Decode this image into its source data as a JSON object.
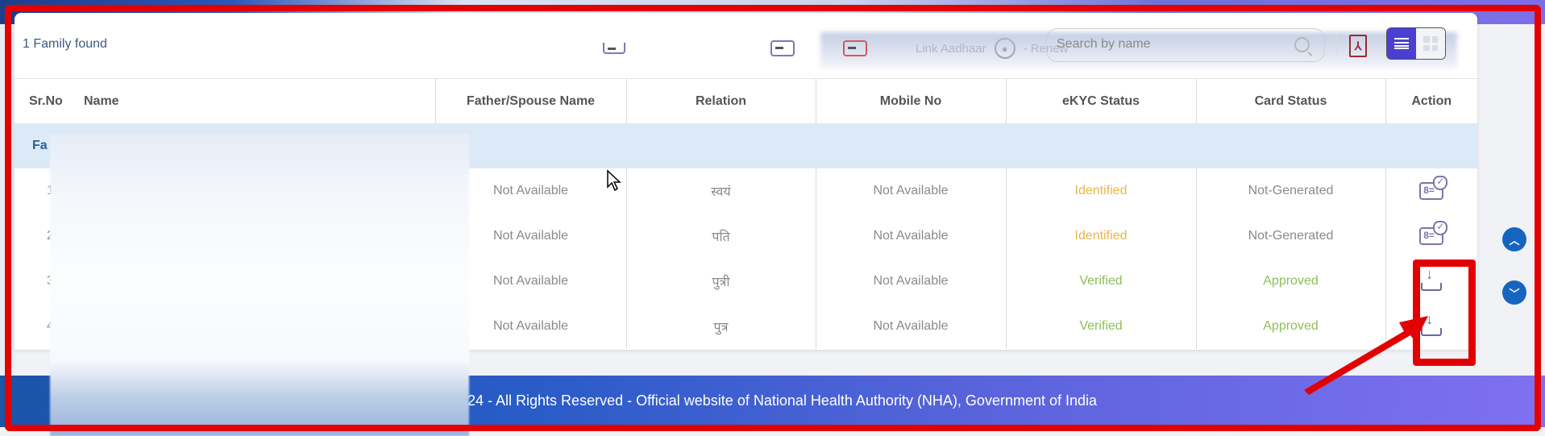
{
  "toolbar": {
    "family_count": "1 Family found",
    "legend": {
      "link_aadhaar_label": "Link Aadhaar",
      "renew_label": "- Renew"
    },
    "search": {
      "placeholder": "Search by name",
      "value": ""
    },
    "pdf_label": "PDF",
    "view_toggle": {
      "active": "list"
    }
  },
  "table": {
    "headers": [
      "Sr.No",
      "Name",
      "Father/Spouse Name",
      "Relation",
      "Mobile No",
      "eKYC Status",
      "Card Status",
      "Action"
    ],
    "family_row_label": "Fa",
    "rows": [
      {
        "sr": "1",
        "name": "",
        "father_spouse": "Not Available",
        "relation": "स्वयं",
        "mobile": "Not Available",
        "ekyc": "Identified",
        "card": "Not-Generated",
        "action": "card-verify-icon"
      },
      {
        "sr": "2",
        "name": "",
        "father_spouse": "Not Available",
        "relation": "पति",
        "mobile": "Not Available",
        "ekyc": "Identified",
        "card": "Not-Generated",
        "action": "card-verify-icon"
      },
      {
        "sr": "3",
        "name": "",
        "father_spouse": "Not Available",
        "relation": "पुत्री",
        "mobile": "Not Available",
        "ekyc": "Verified",
        "card": "Approved",
        "action": "download-icon"
      },
      {
        "sr": "4",
        "name": "",
        "father_spouse": "Not Available",
        "relation": "पुत्र",
        "mobile": "Not Available",
        "ekyc": "Verified",
        "card": "Approved",
        "action": "download-icon"
      }
    ]
  },
  "footer": {
    "text": "024 - All Rights Reserved - Official website of National Health Authority (NHA), Government of India"
  },
  "colors": {
    "identified": "#e9b548",
    "verified": "#8fbd56",
    "accent": "#4b3fd1",
    "annotation_red": "#e30000"
  }
}
